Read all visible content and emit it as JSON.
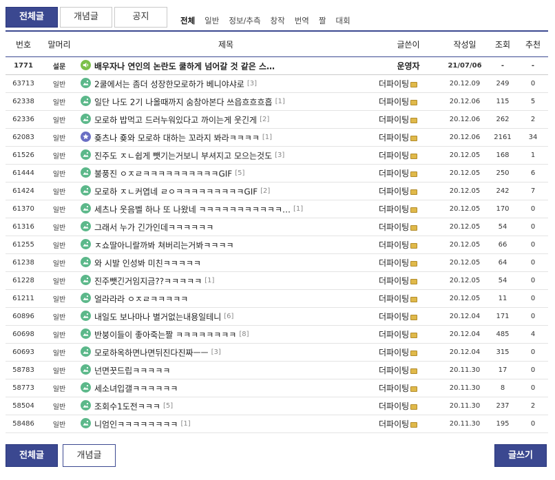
{
  "top_tabs": [
    "전체글",
    "개념글",
    "공지"
  ],
  "categories": [
    "전체",
    "일반",
    "정보/추측",
    "창작",
    "번역",
    "짤",
    "대회"
  ],
  "columns": [
    "번호",
    "말머리",
    "제목",
    "글쓴이",
    "작성일",
    "조회",
    "추천"
  ],
  "notice": {
    "no": "1771",
    "head": "설문",
    "title": "배우자나 연인의 논란도 쿨하게 넘어갈 것 같은 스…",
    "writer": "운영자",
    "date": "21/07/06",
    "views": "-",
    "recs": "-"
  },
  "rows": [
    {
      "no": "63713",
      "head": "일반",
      "title": "2쿨에서는 좀더 성장한모로하가 베니야샤로",
      "replies": "[3]",
      "writer": "더파이팅",
      "date": "20.12.09",
      "views": "249",
      "recs": "0",
      "icon": "image"
    },
    {
      "no": "62338",
      "head": "일반",
      "title": "일단 나도 2기 나올때까지 숨참아본다 쓰읍흐흐흐흡",
      "replies": "[1]",
      "writer": "더파이팅",
      "date": "20.12.06",
      "views": "115",
      "recs": "5",
      "icon": "image"
    },
    {
      "no": "62336",
      "head": "일반",
      "title": "모로하 밥먹고 드러누워있다고 까이는게 웃긴게",
      "replies": "[2]",
      "writer": "더파이팅",
      "date": "20.12.06",
      "views": "262",
      "recs": "2",
      "icon": "image"
    },
    {
      "no": "62083",
      "head": "일반",
      "title": "죶츠나 죶와 모로하 대하는 꼬라지 봐라ㅋㅋㅋㅋ",
      "replies": "[1]",
      "writer": "더파이팅",
      "date": "20.12.06",
      "views": "2161",
      "recs": "34",
      "icon": "star"
    },
    {
      "no": "61526",
      "head": "일반",
      "title": "진주도 ㅈㄴ쉽게 뺏기는거보니 부셔지고 모으는것도",
      "replies": "[3]",
      "writer": "더파이팅",
      "date": "20.12.05",
      "views": "168",
      "recs": "1",
      "icon": "image"
    },
    {
      "no": "61444",
      "head": "일반",
      "title": "불풍진 ㅇㅈㄹㅋㅋㅋㅋㅋㅋㅋㅋㅋㅋGIF",
      "replies": "[5]",
      "writer": "더파이팅",
      "date": "20.12.05",
      "views": "250",
      "recs": "6",
      "icon": "image"
    },
    {
      "no": "61424",
      "head": "일반",
      "title": "모로하 ㅈㄴ커엽네 ㄹㅇㅋㅋㅋㅋㅋㅋㅋㅋㅋGIF",
      "replies": "[2]",
      "writer": "더파이팅",
      "date": "20.12.05",
      "views": "242",
      "recs": "7",
      "icon": "image"
    },
    {
      "no": "61370",
      "head": "일반",
      "title": "세츠나 웃음벨 하나 또 나왔네 ㅋㅋㅋㅋㅋㅋㅋㅋㅋㅋㅋ…",
      "replies": "[1]",
      "writer": "더파이팅",
      "date": "20.12.05",
      "views": "170",
      "recs": "0",
      "icon": "image"
    },
    {
      "no": "61316",
      "head": "일반",
      "title": "그래서 누가 긴가인데ㅋㅋㅋㅋㅋㅋ",
      "replies": "",
      "writer": "더파이팅",
      "date": "20.12.05",
      "views": "54",
      "recs": "0",
      "icon": "image"
    },
    {
      "no": "61255",
      "head": "일반",
      "title": "ㅈ쇼딸아니랄까봐 쳐버리는거봐ㅋㅋㅋㅋ",
      "replies": "",
      "writer": "더파이팅",
      "date": "20.12.05",
      "views": "66",
      "recs": "0",
      "icon": "image"
    },
    {
      "no": "61238",
      "head": "일반",
      "title": "와 시발 인성봐 미친ㅋㅋㅋㅋㅋ",
      "replies": "",
      "writer": "더파이팅",
      "date": "20.12.05",
      "views": "64",
      "recs": "0",
      "icon": "image"
    },
    {
      "no": "61228",
      "head": "일반",
      "title": "진주뺏긴거임지금??ㅋㅋㅋㅋㅋ",
      "replies": "[1]",
      "writer": "더파이팅",
      "date": "20.12.05",
      "views": "54",
      "recs": "0",
      "icon": "image"
    },
    {
      "no": "61211",
      "head": "일반",
      "title": "얼라라라 ㅇㅈㄹㅋㅋㅋㅋㅋ",
      "replies": "",
      "writer": "더파이팅",
      "date": "20.12.05",
      "views": "11",
      "recs": "0",
      "icon": "image"
    },
    {
      "no": "60896",
      "head": "일반",
      "title": "내일도 보나마나 별거없는내용일테니",
      "replies": "[6]",
      "writer": "더파이팅",
      "date": "20.12.04",
      "views": "171",
      "recs": "0",
      "icon": "image"
    },
    {
      "no": "60698",
      "head": "일반",
      "title": "반붕이들이 좋아죽는짤 ㅋㅋㅋㅋㅋㅋㅋㅋ",
      "replies": "[8]",
      "writer": "더파이팅",
      "date": "20.12.04",
      "views": "485",
      "recs": "4",
      "icon": "image"
    },
    {
      "no": "60693",
      "head": "일반",
      "title": "모로하옥하면나면뒤진다진짜ㅡㅡ",
      "replies": "[3]",
      "writer": "더파이팅",
      "date": "20.12.04",
      "views": "315",
      "recs": "0",
      "icon": "image"
    },
    {
      "no": "58783",
      "head": "일반",
      "title": "넌면꿋드립ㅋㅋㅋㅋㅋ",
      "replies": "",
      "writer": "더파이팅",
      "date": "20.11.30",
      "views": "17",
      "recs": "0",
      "icon": "image"
    },
    {
      "no": "58773",
      "head": "일반",
      "title": "세소녀입갤ㅋㅋㅋㅋㅋㅋ",
      "replies": "",
      "writer": "더파이팅",
      "date": "20.11.30",
      "views": "8",
      "recs": "0",
      "icon": "image"
    },
    {
      "no": "58504",
      "head": "일반",
      "title": "조회수1도전ㅋㅋㅋ",
      "replies": "[5]",
      "writer": "더파이팅",
      "date": "20.11.30",
      "views": "237",
      "recs": "2",
      "icon": "image"
    },
    {
      "no": "58486",
      "head": "일반",
      "title": "니엄인ㅋㅋㅋㅋㅋㅋㅋㅋ",
      "replies": "[1]",
      "writer": "더파이팅",
      "date": "20.11.30",
      "views": "195",
      "recs": "0",
      "icon": "image"
    }
  ],
  "bottom": {
    "all": "전체글",
    "concept": "개념글",
    "write": "글쓰기"
  },
  "colors": {
    "accent": "#3b4890",
    "icon_green": "#5cb88a",
    "icon_star": "#6a6fc4",
    "icon_notice": "#7cc04a"
  }
}
